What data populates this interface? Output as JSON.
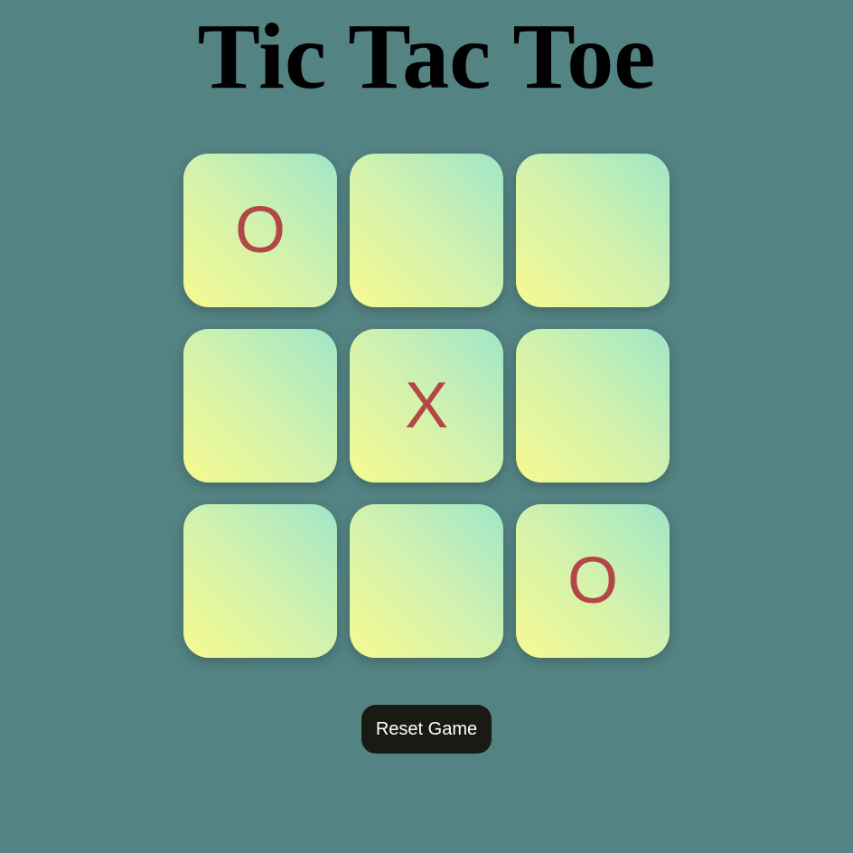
{
  "title": "Tic Tac Toe",
  "board": {
    "cells": [
      {
        "mark": "O"
      },
      {
        "mark": ""
      },
      {
        "mark": ""
      },
      {
        "mark": ""
      },
      {
        "mark": "X"
      },
      {
        "mark": ""
      },
      {
        "mark": ""
      },
      {
        "mark": ""
      },
      {
        "mark": "O"
      }
    ]
  },
  "reset_label": "Reset Game",
  "colors": {
    "background": "#548383",
    "mark": "#b34747",
    "cell_gradient_top": "#a0e6c8",
    "cell_gradient_bottom": "#f6fa90",
    "button": "#1a1a14"
  }
}
